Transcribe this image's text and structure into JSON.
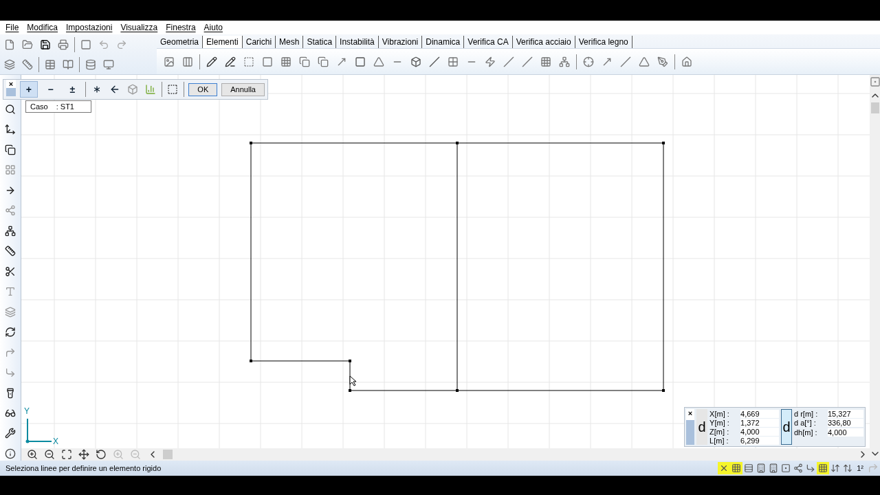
{
  "menu": [
    "File",
    "Modifica",
    "Impostazioni",
    "Visualizza",
    "Finestra",
    "Aiuto"
  ],
  "tabs": [
    {
      "label": "Geometria",
      "selected": false
    },
    {
      "label": "Elementi",
      "selected": true
    },
    {
      "label": "Carichi",
      "selected": false
    },
    {
      "label": "Mesh",
      "selected": false
    },
    {
      "label": "Statica",
      "selected": false
    },
    {
      "label": "Instabilità",
      "selected": false
    },
    {
      "label": "Vibrazioni",
      "selected": false
    },
    {
      "label": "Dinamica",
      "selected": false
    },
    {
      "label": "Verifica CA",
      "selected": false
    },
    {
      "label": "Verifica acciaio",
      "selected": false
    },
    {
      "label": "Verifica legno",
      "selected": false
    }
  ],
  "selection_toolbar": {
    "close": "×",
    "modes": [
      {
        "label": "+",
        "selected": true
      },
      {
        "label": "−",
        "selected": false
      },
      {
        "label": "±",
        "selected": false
      }
    ],
    "ok": "OK",
    "cancel": "Annulla"
  },
  "tooltip": {
    "label": "Caso",
    "value": ": ST1"
  },
  "axes": {
    "y": "Y",
    "x": "X"
  },
  "coordinates": {
    "close": "×",
    "left_toggle": {
      "label": "d",
      "selected": false
    },
    "right_toggle": {
      "label": "d",
      "selected": true
    },
    "left": [
      {
        "label": "X[m] :",
        "value": "4,669"
      },
      {
        "label": "Y[m] :",
        "value": "1,372"
      },
      {
        "label": "Z[m] :",
        "value": "4,000"
      },
      {
        "label": "L[m] :",
        "value": "6,299"
      }
    ],
    "right": [
      {
        "label": "d r[m] :",
        "value": "15,327"
      },
      {
        "label": "d  a[°] :",
        "value": "336,80"
      },
      {
        "label": "dh[m] :",
        "value": "4,000"
      }
    ]
  },
  "status": {
    "message": "Seleziona linee per definire un elemento rigido",
    "superscript_label": "1²",
    "toggles": [
      {
        "on": true
      },
      {
        "on": true
      },
      {
        "on": false
      },
      {
        "on": false
      },
      {
        "on": false
      },
      {
        "on": false
      },
      {
        "on": false
      },
      {
        "on": false
      },
      {
        "on": true
      },
      {
        "on": false
      },
      {
        "on": false
      }
    ]
  }
}
